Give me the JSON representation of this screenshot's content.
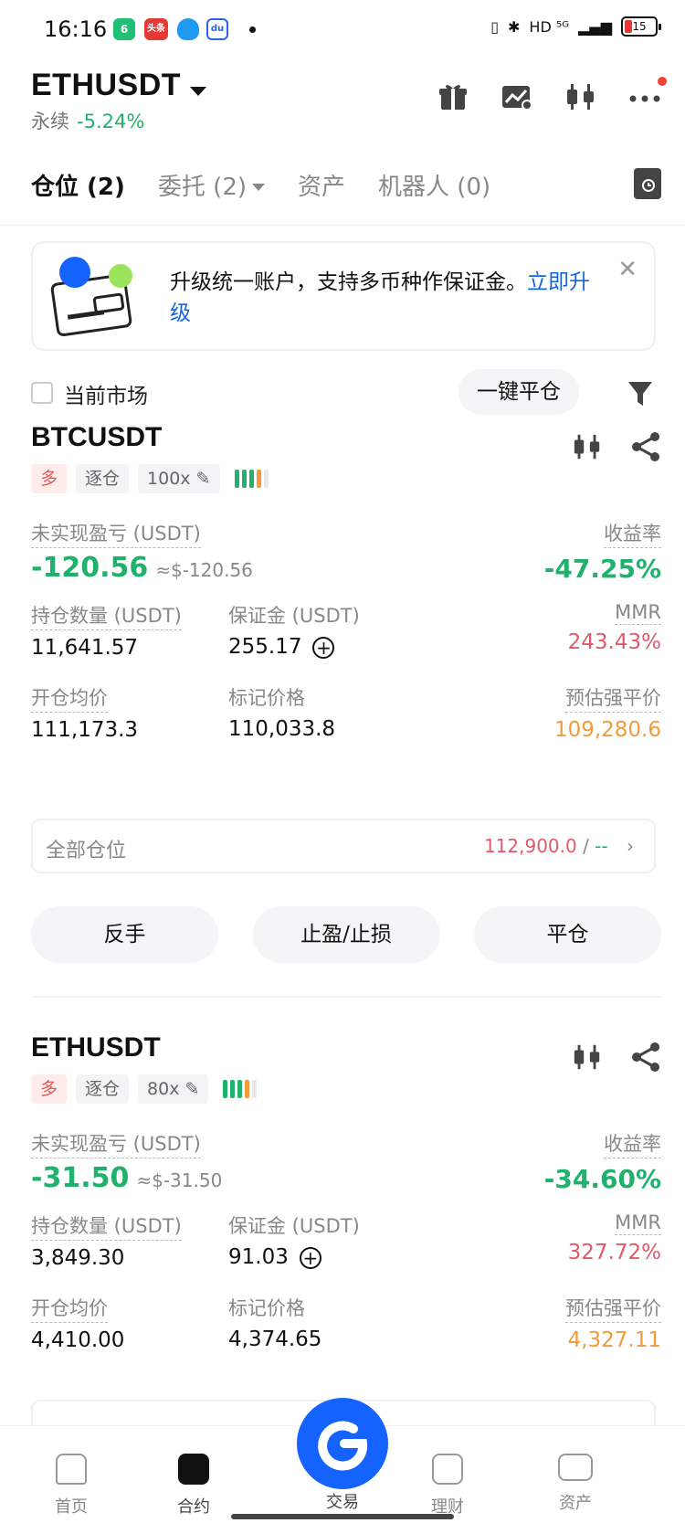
{
  "status_bar": {
    "time": "16:16",
    "app_icons": [
      {
        "name": "green-app-icon",
        "label": "6",
        "color": "#1fbf75"
      },
      {
        "name": "toutiao-icon",
        "label": "头条",
        "color": "#e53935"
      },
      {
        "name": "qq-icon",
        "label": "",
        "color": "#1e9bf0"
      },
      {
        "name": "baidu-icon",
        "label": "du",
        "color": "#2a64ea"
      }
    ],
    "indicators": "HD ⁵ᴳ",
    "battery": "15"
  },
  "header": {
    "pair": "ETHUSDT",
    "type_label": "永续",
    "change": "-5.24%"
  },
  "tabs": [
    {
      "label": "仓位 (2)",
      "active": true
    },
    {
      "label": "委托 (2)",
      "active": false,
      "dropdown": true
    },
    {
      "label": "资产",
      "active": false
    },
    {
      "label": "机器人 (0)",
      "active": false
    }
  ],
  "banner": {
    "text": "升级统一账户，支持多币种作保证金。",
    "link": "立即升级"
  },
  "filter": {
    "current_market_label": "当前市场",
    "close_all_label": "一键平仓"
  },
  "positions": [
    {
      "symbol": "BTCUSDT",
      "side": "多",
      "margin_mode": "逐仓",
      "leverage": "100x",
      "unrealized_label": "未实现盈亏 (USDT)",
      "unrealized": "-120.56",
      "unrealized_usd": "≈$-120.56",
      "roe_label": "收益率",
      "roe": "-47.25%",
      "size_label": "持仓数量 (USDT)",
      "size": "11,641.57",
      "margin_label": "保证金 (USDT)",
      "margin": "255.17",
      "mmr_label": "MMR",
      "mmr": "243.43%",
      "entry_label": "开仓均价",
      "entry": "111,173.3",
      "mark_label": "标记价格",
      "mark": "110,033.8",
      "liq_label": "预估强平价",
      "liq": "109,280.6",
      "all_label": "全部仓位",
      "tp": "112,900.0",
      "sl": "--"
    },
    {
      "symbol": "ETHUSDT",
      "side": "多",
      "margin_mode": "逐仓",
      "leverage": "80x",
      "unrealized_label": "未实现盈亏 (USDT)",
      "unrealized": "-31.50",
      "unrealized_usd": "≈$-31.50",
      "roe_label": "收益率",
      "roe": "-34.60%",
      "size_label": "持仓数量 (USDT)",
      "size": "3,849.30",
      "margin_label": "保证金 (USDT)",
      "margin": "91.03",
      "mmr_label": "MMR",
      "mmr": "327.72%",
      "entry_label": "开仓均价",
      "entry": "4,410.00",
      "mark_label": "标记价格",
      "mark": "4,374.65",
      "liq_label": "预估强平价",
      "liq": "4,327.11"
    }
  ],
  "actions": {
    "reverse": "反手",
    "tpsl": "止盈/止损",
    "close": "平仓"
  },
  "bottom_nav": [
    {
      "label": "首页",
      "icon": "home-icon"
    },
    {
      "label": "合约",
      "icon": "futures-icon",
      "active": true
    },
    {
      "label": "交易",
      "icon": "trade-icon"
    },
    {
      "label": "理财",
      "icon": "earn-icon"
    },
    {
      "label": "资产",
      "icon": "wallet-icon"
    }
  ],
  "colors": {
    "green": "#20b26c",
    "red": "#e05a6a",
    "orange": "#f39a39",
    "link": "#1565e0",
    "trade_button": "#1463ff"
  }
}
